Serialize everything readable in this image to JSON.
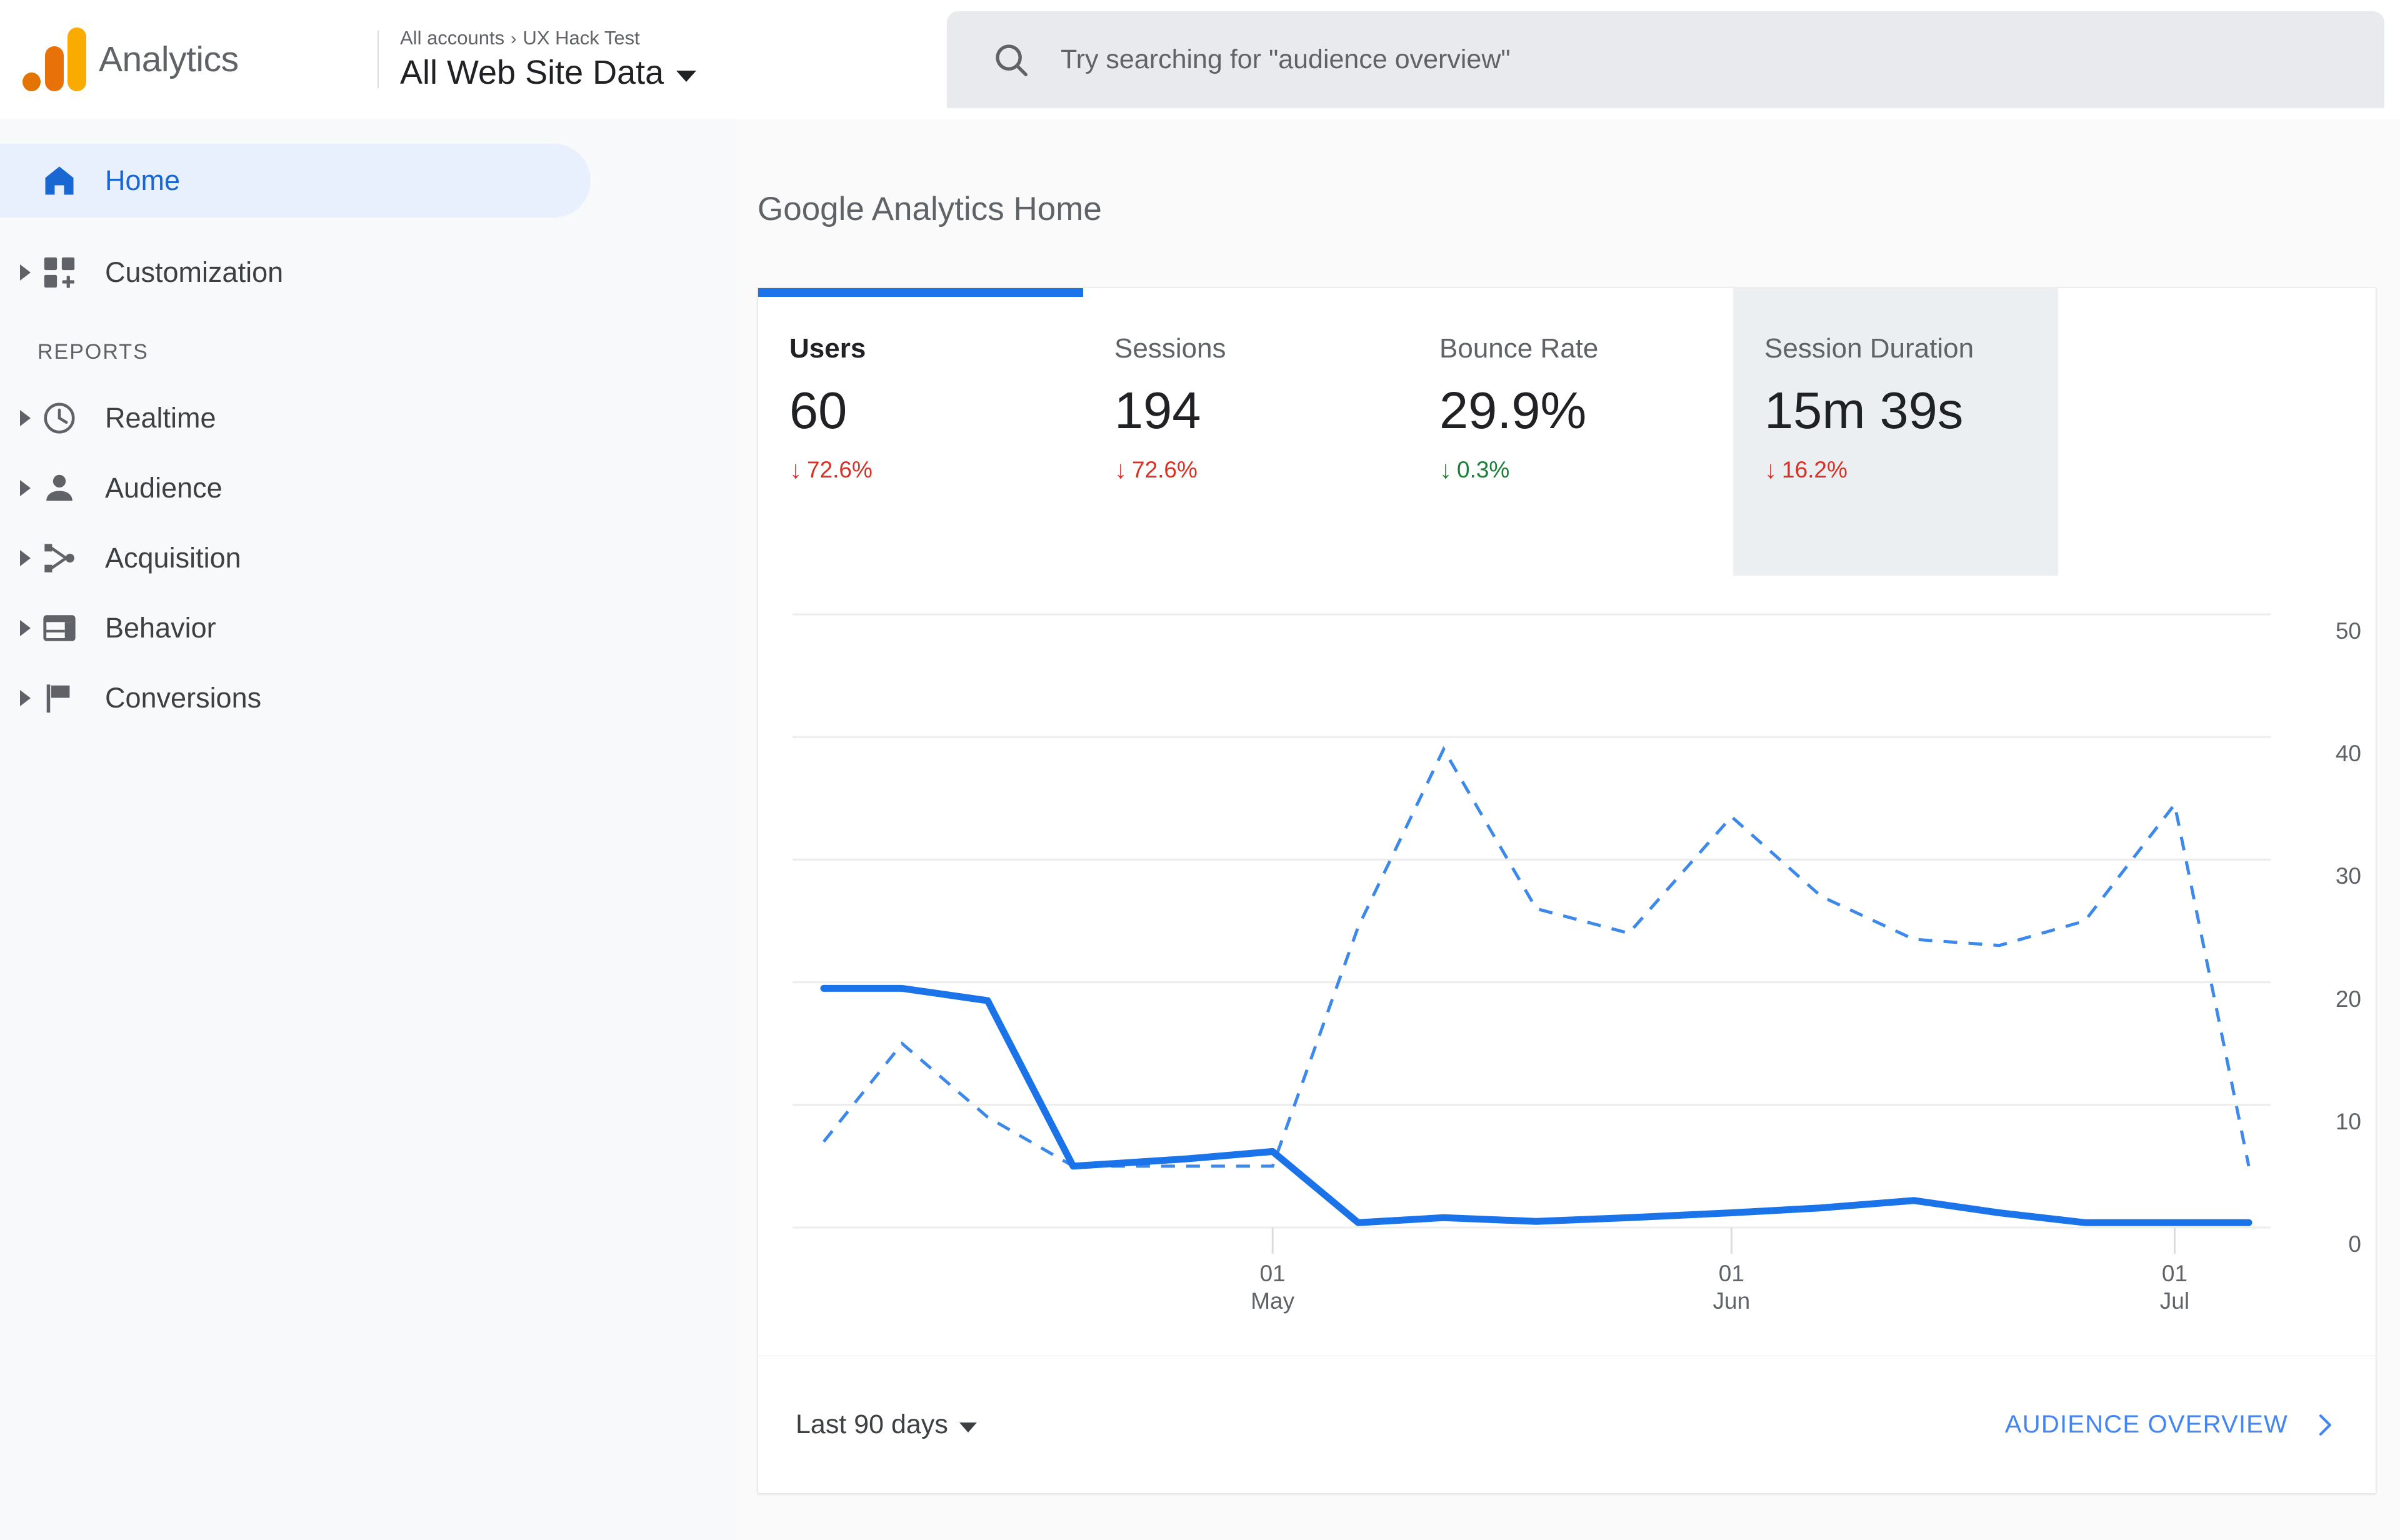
{
  "header": {
    "brand": "Analytics",
    "logo_colors": {
      "dot": "#E37400",
      "mid": "#E8710A",
      "tall": "#F9AB00"
    },
    "breadcrumb": {
      "account": "All accounts",
      "separator": "›",
      "property": "UX Hack Test"
    },
    "property_view": "All Web Site Data",
    "search_placeholder": "Try searching for \"audience overview\"",
    "search_value": ""
  },
  "sidebar": {
    "home": {
      "label": "Home",
      "icon": "home-icon",
      "active": true
    },
    "customization": {
      "label": "Customization",
      "icon": "customization-icon"
    },
    "section_label": "REPORTS",
    "reports": [
      {
        "label": "Realtime",
        "icon": "clock-icon"
      },
      {
        "label": "Audience",
        "icon": "person-icon"
      },
      {
        "label": "Acquisition",
        "icon": "share-icon"
      },
      {
        "label": "Behavior",
        "icon": "window-icon"
      },
      {
        "label": "Conversions",
        "icon": "flag-icon"
      }
    ]
  },
  "main": {
    "page_title": "Google Analytics Home",
    "metrics": [
      {
        "label": "Users",
        "value": "60",
        "delta": "72.6%",
        "direction": "down",
        "tone": "bad",
        "state": "active"
      },
      {
        "label": "Sessions",
        "value": "194",
        "delta": "72.6%",
        "direction": "down",
        "tone": "bad",
        "state": "normal"
      },
      {
        "label": "Bounce Rate",
        "value": "29.9%",
        "delta": "0.3%",
        "direction": "down",
        "tone": "good",
        "state": "normal"
      },
      {
        "label": "Session Duration",
        "value": "15m 39s",
        "delta": "16.2%",
        "direction": "down",
        "tone": "bad",
        "state": "hovered"
      }
    ],
    "footer": {
      "date_range": "Last 90 days",
      "audience_link": "AUDIENCE OVERVIEW"
    }
  },
  "chart_data": {
    "type": "line",
    "title": "",
    "xlabel": "",
    "ylabel": "",
    "ylim": [
      0,
      50
    ],
    "yticks": [
      0,
      10,
      20,
      30,
      40,
      50
    ],
    "grid": true,
    "legend": "none",
    "accent_color": "#1a73e8",
    "xticks": [
      {
        "day": "01",
        "month": "May",
        "x_frac": 0.315
      },
      {
        "day": "01",
        "month": "Jun",
        "x_frac": 0.637
      },
      {
        "day": "01",
        "month": "Jul",
        "x_frac": 0.948
      }
    ],
    "series": [
      {
        "name": "Users (current period)",
        "style": "solid",
        "x": [
          0.0,
          0.055,
          0.115,
          0.175,
          0.255,
          0.315,
          0.375,
          0.435,
          0.5,
          0.565,
          0.637,
          0.7,
          0.765,
          0.825,
          0.885,
          0.948,
          1.0
        ],
        "values": [
          19.5,
          19.5,
          18.5,
          5.0,
          5.6,
          6.2,
          0.4,
          0.8,
          0.5,
          0.8,
          1.2,
          1.6,
          2.2,
          1.2,
          0.4,
          0.4,
          0.4
        ]
      },
      {
        "name": "Users (previous period)",
        "style": "dashed",
        "x": [
          0.0,
          0.055,
          0.115,
          0.175,
          0.255,
          0.315,
          0.375,
          0.435,
          0.5,
          0.565,
          0.637,
          0.7,
          0.765,
          0.825,
          0.885,
          0.948,
          1.0
        ],
        "values": [
          7.0,
          15.0,
          9.0,
          5.0,
          5.0,
          5.0,
          24.5,
          39.0,
          26.0,
          24.0,
          33.5,
          27.0,
          23.5,
          23.0,
          25.0,
          34.5,
          5.0
        ]
      }
    ]
  }
}
